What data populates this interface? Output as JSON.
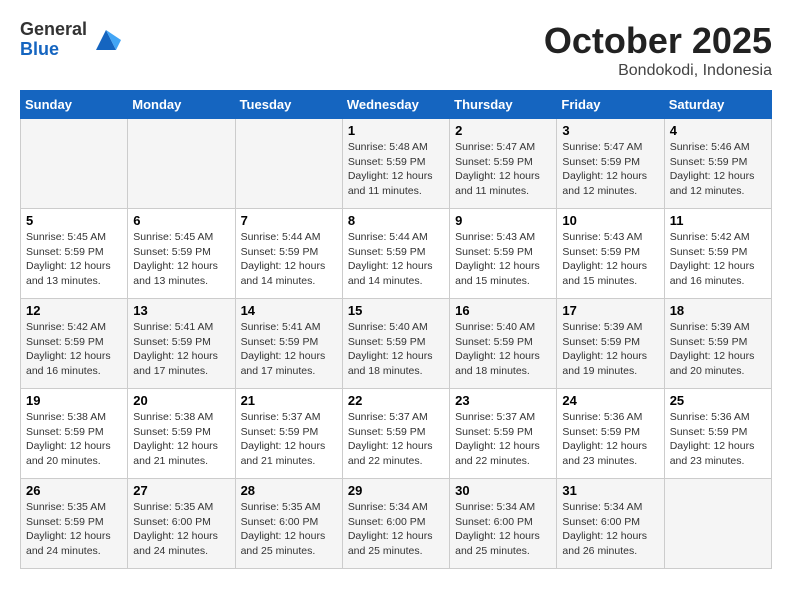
{
  "header": {
    "logo_general": "General",
    "logo_blue": "Blue",
    "month_title": "October 2025",
    "subtitle": "Bondokodi, Indonesia"
  },
  "days_of_week": [
    "Sunday",
    "Monday",
    "Tuesday",
    "Wednesday",
    "Thursday",
    "Friday",
    "Saturday"
  ],
  "weeks": [
    {
      "days": [
        {
          "number": "",
          "info": ""
        },
        {
          "number": "",
          "info": ""
        },
        {
          "number": "",
          "info": ""
        },
        {
          "number": "1",
          "info": "Sunrise: 5:48 AM\nSunset: 5:59 PM\nDaylight: 12 hours\nand 11 minutes."
        },
        {
          "number": "2",
          "info": "Sunrise: 5:47 AM\nSunset: 5:59 PM\nDaylight: 12 hours\nand 11 minutes."
        },
        {
          "number": "3",
          "info": "Sunrise: 5:47 AM\nSunset: 5:59 PM\nDaylight: 12 hours\nand 12 minutes."
        },
        {
          "number": "4",
          "info": "Sunrise: 5:46 AM\nSunset: 5:59 PM\nDaylight: 12 hours\nand 12 minutes."
        }
      ]
    },
    {
      "days": [
        {
          "number": "5",
          "info": "Sunrise: 5:45 AM\nSunset: 5:59 PM\nDaylight: 12 hours\nand 13 minutes."
        },
        {
          "number": "6",
          "info": "Sunrise: 5:45 AM\nSunset: 5:59 PM\nDaylight: 12 hours\nand 13 minutes."
        },
        {
          "number": "7",
          "info": "Sunrise: 5:44 AM\nSunset: 5:59 PM\nDaylight: 12 hours\nand 14 minutes."
        },
        {
          "number": "8",
          "info": "Sunrise: 5:44 AM\nSunset: 5:59 PM\nDaylight: 12 hours\nand 14 minutes."
        },
        {
          "number": "9",
          "info": "Sunrise: 5:43 AM\nSunset: 5:59 PM\nDaylight: 12 hours\nand 15 minutes."
        },
        {
          "number": "10",
          "info": "Sunrise: 5:43 AM\nSunset: 5:59 PM\nDaylight: 12 hours\nand 15 minutes."
        },
        {
          "number": "11",
          "info": "Sunrise: 5:42 AM\nSunset: 5:59 PM\nDaylight: 12 hours\nand 16 minutes."
        }
      ]
    },
    {
      "days": [
        {
          "number": "12",
          "info": "Sunrise: 5:42 AM\nSunset: 5:59 PM\nDaylight: 12 hours\nand 16 minutes."
        },
        {
          "number": "13",
          "info": "Sunrise: 5:41 AM\nSunset: 5:59 PM\nDaylight: 12 hours\nand 17 minutes."
        },
        {
          "number": "14",
          "info": "Sunrise: 5:41 AM\nSunset: 5:59 PM\nDaylight: 12 hours\nand 17 minutes."
        },
        {
          "number": "15",
          "info": "Sunrise: 5:40 AM\nSunset: 5:59 PM\nDaylight: 12 hours\nand 18 minutes."
        },
        {
          "number": "16",
          "info": "Sunrise: 5:40 AM\nSunset: 5:59 PM\nDaylight: 12 hours\nand 18 minutes."
        },
        {
          "number": "17",
          "info": "Sunrise: 5:39 AM\nSunset: 5:59 PM\nDaylight: 12 hours\nand 19 minutes."
        },
        {
          "number": "18",
          "info": "Sunrise: 5:39 AM\nSunset: 5:59 PM\nDaylight: 12 hours\nand 20 minutes."
        }
      ]
    },
    {
      "days": [
        {
          "number": "19",
          "info": "Sunrise: 5:38 AM\nSunset: 5:59 PM\nDaylight: 12 hours\nand 20 minutes."
        },
        {
          "number": "20",
          "info": "Sunrise: 5:38 AM\nSunset: 5:59 PM\nDaylight: 12 hours\nand 21 minutes."
        },
        {
          "number": "21",
          "info": "Sunrise: 5:37 AM\nSunset: 5:59 PM\nDaylight: 12 hours\nand 21 minutes."
        },
        {
          "number": "22",
          "info": "Sunrise: 5:37 AM\nSunset: 5:59 PM\nDaylight: 12 hours\nand 22 minutes."
        },
        {
          "number": "23",
          "info": "Sunrise: 5:37 AM\nSunset: 5:59 PM\nDaylight: 12 hours\nand 22 minutes."
        },
        {
          "number": "24",
          "info": "Sunrise: 5:36 AM\nSunset: 5:59 PM\nDaylight: 12 hours\nand 23 minutes."
        },
        {
          "number": "25",
          "info": "Sunrise: 5:36 AM\nSunset: 5:59 PM\nDaylight: 12 hours\nand 23 minutes."
        }
      ]
    },
    {
      "days": [
        {
          "number": "26",
          "info": "Sunrise: 5:35 AM\nSunset: 5:59 PM\nDaylight: 12 hours\nand 24 minutes."
        },
        {
          "number": "27",
          "info": "Sunrise: 5:35 AM\nSunset: 6:00 PM\nDaylight: 12 hours\nand 24 minutes."
        },
        {
          "number": "28",
          "info": "Sunrise: 5:35 AM\nSunset: 6:00 PM\nDaylight: 12 hours\nand 25 minutes."
        },
        {
          "number": "29",
          "info": "Sunrise: 5:34 AM\nSunset: 6:00 PM\nDaylight: 12 hours\nand 25 minutes."
        },
        {
          "number": "30",
          "info": "Sunrise: 5:34 AM\nSunset: 6:00 PM\nDaylight: 12 hours\nand 25 minutes."
        },
        {
          "number": "31",
          "info": "Sunrise: 5:34 AM\nSunset: 6:00 PM\nDaylight: 12 hours\nand 26 minutes."
        },
        {
          "number": "",
          "info": ""
        }
      ]
    }
  ]
}
